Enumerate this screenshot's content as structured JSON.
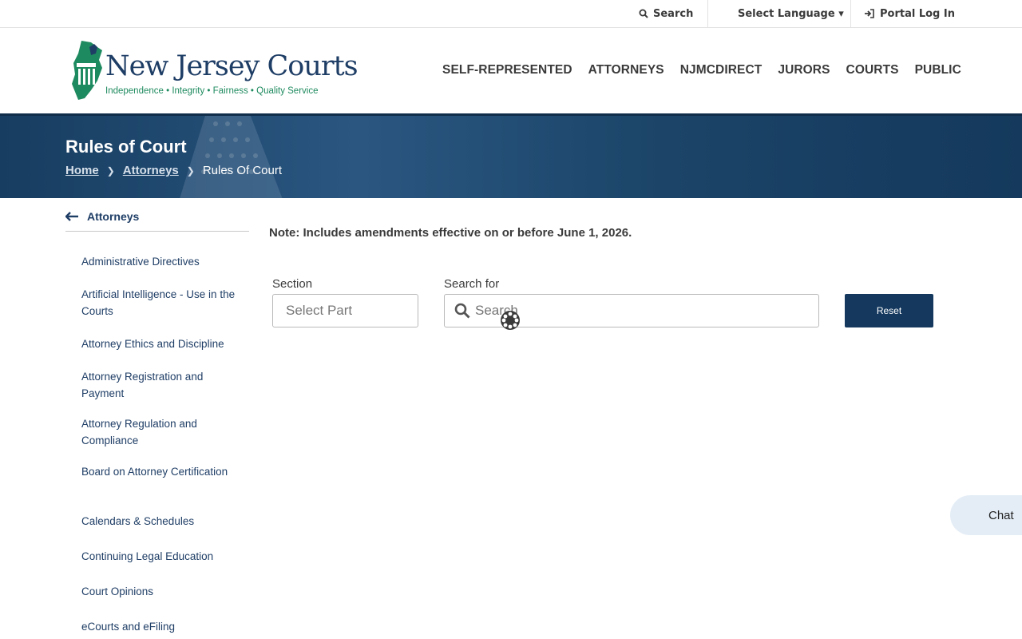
{
  "topbar": {
    "search": "Search",
    "language": "Select Language ▾",
    "portal": "Portal Log In"
  },
  "logo": {
    "title": "New Jersey Courts",
    "tagline": "Independence • Integrity • Fairness • Quality Service"
  },
  "nav": {
    "items": [
      "SELF-REPRESENTED",
      "ATTORNEYS",
      "NJMCDIRECT",
      "JURORS",
      "COURTS",
      "PUBLIC"
    ]
  },
  "banner": {
    "title": "Rules of Court",
    "breadcrumb": [
      "Home",
      "Attorneys",
      "Rules Of Court"
    ]
  },
  "sidebar": {
    "back_label": "Attorneys",
    "items": [
      "Administrative Directives",
      "Artificial Intelligence - Use in the Courts",
      "Attorney Ethics and Discipline",
      "Attorney Registration and Payment",
      "Attorney Regulation and Compliance",
      "Board on Attorney Certification",
      "Calendars & Schedules",
      "Continuing Legal Education",
      "Court Opinions",
      "eCourts and eFiling"
    ]
  },
  "main": {
    "note": "Note: Includes amendments effective on or before June 1, 2026.",
    "section_label": "Section",
    "section_placeholder": "Select Part",
    "search_label": "Search for",
    "search_placeholder": "Search",
    "reset_label": "Reset"
  },
  "chat": {
    "label": "Chat"
  },
  "colors": {
    "brand_navy": "#1f3e66",
    "button": "#14385e",
    "tagline_green": "#1e8a5f"
  }
}
